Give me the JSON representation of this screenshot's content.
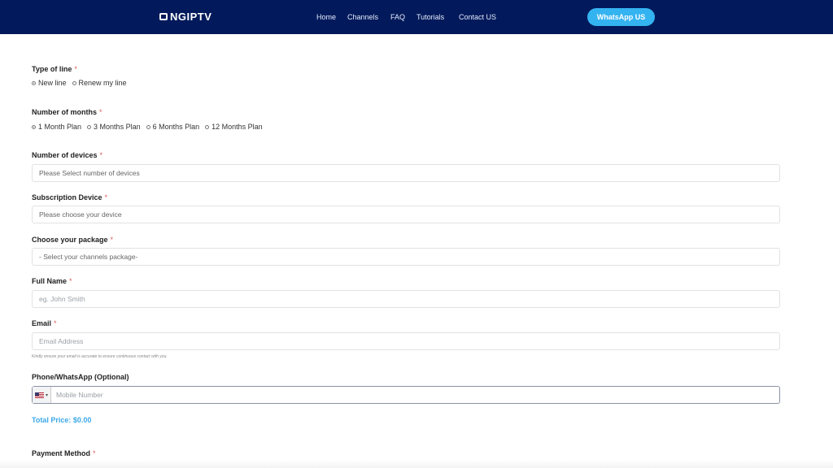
{
  "header": {
    "logo_text": "NGIPTV",
    "nav": [
      "Home",
      "Channels",
      "FAQ",
      "Tutorials",
      "Contact US"
    ],
    "cta_label": "WhatsApp US"
  },
  "form": {
    "required_mark": "*",
    "type_of_line": {
      "label": "Type of line",
      "options": [
        "New line",
        "Renew my line"
      ],
      "selected": "New line"
    },
    "months": {
      "label": "Number of months",
      "options": [
        "1 Month Plan",
        "3 Months Plan",
        "6 Months Plan",
        "12 Months Plan"
      ],
      "selected": "1 Month Plan"
    },
    "devices": {
      "label": "Number of devices",
      "value": "Please Select number of devices"
    },
    "subscription_device": {
      "label": "Subscription Device",
      "value": "Please choose your device"
    },
    "package": {
      "label": "Choose your package",
      "value": "- Select your channels package-"
    },
    "full_name": {
      "label": "Full Name",
      "placeholder": "eg. John Smith"
    },
    "email": {
      "label": "Email",
      "placeholder": "Email Address",
      "hint": "Kindly ensure your email is accurate to ensure continuous contact with you."
    },
    "phone": {
      "label": "Phone/WhatsApp (Optional)",
      "placeholder": "Mobile Number",
      "country": "US"
    },
    "total_price": "Total Price: $0.00",
    "payment_method": {
      "label": "Payment Method"
    }
  }
}
